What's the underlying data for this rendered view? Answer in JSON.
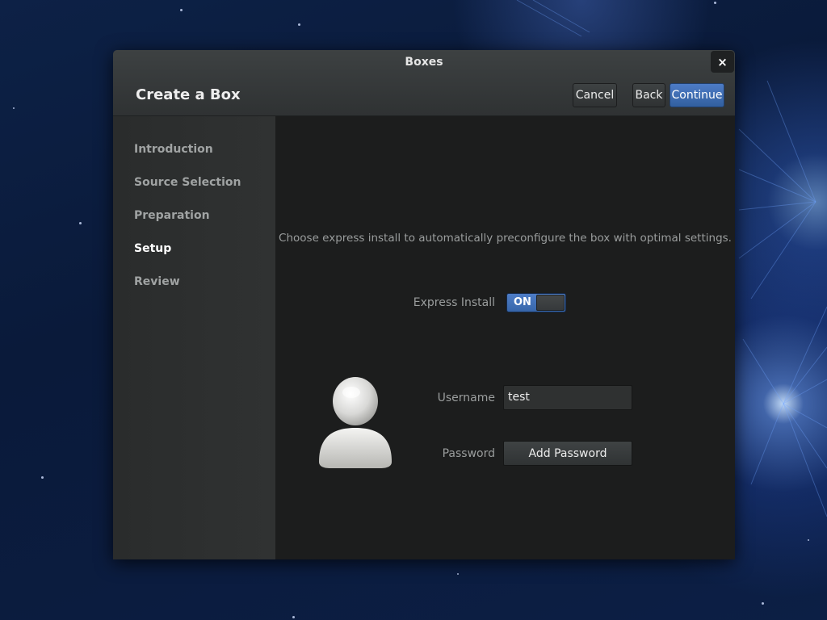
{
  "window": {
    "title": "Boxes",
    "close_symbol": "×"
  },
  "header": {
    "title": "Create a Box",
    "cancel_label": "Cancel",
    "back_label": "Back",
    "continue_label": "Continue"
  },
  "sidebar": {
    "items": [
      {
        "label": "Introduction",
        "active": false
      },
      {
        "label": "Source Selection",
        "active": false
      },
      {
        "label": "Preparation",
        "active": false
      },
      {
        "label": "Setup",
        "active": true
      },
      {
        "label": "Review",
        "active": false
      }
    ]
  },
  "setup": {
    "hint": "Choose express install to automatically preconfigure the box with optimal settings.",
    "express_install_label": "Express Install",
    "express_install_state": "ON",
    "username_label": "Username",
    "username_value": "test",
    "password_label": "Password",
    "password_button_label": "Add Password"
  },
  "icons": {
    "close": "close-icon",
    "avatar": "user-avatar-icon"
  },
  "colors": {
    "accent": "#4a78c0",
    "window_bg": "#2b2d2e",
    "content_bg": "#1c1d1d",
    "active_text": "#ffffff",
    "muted_text": "#a0a3a3"
  }
}
